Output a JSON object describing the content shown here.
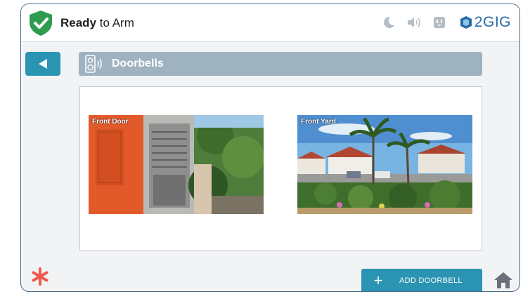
{
  "status": {
    "bold": "Ready",
    "rest": " to Arm"
  },
  "status_icons": [
    "moon-icon",
    "speaker-icon",
    "outlet-icon"
  ],
  "brand": "2GIG",
  "page": {
    "title": "Doorbells"
  },
  "doorbells": [
    {
      "label": "Front Door"
    },
    {
      "label": "Front Yard"
    }
  ],
  "actions": {
    "add_doorbell": "ADD DOORBELL"
  },
  "colors": {
    "accent": "#2a94b2",
    "title_bar": "#9fb2c0",
    "shield": "#2e9b4f",
    "brand": "#2a6aa8",
    "asterisk": "#f0584e"
  }
}
